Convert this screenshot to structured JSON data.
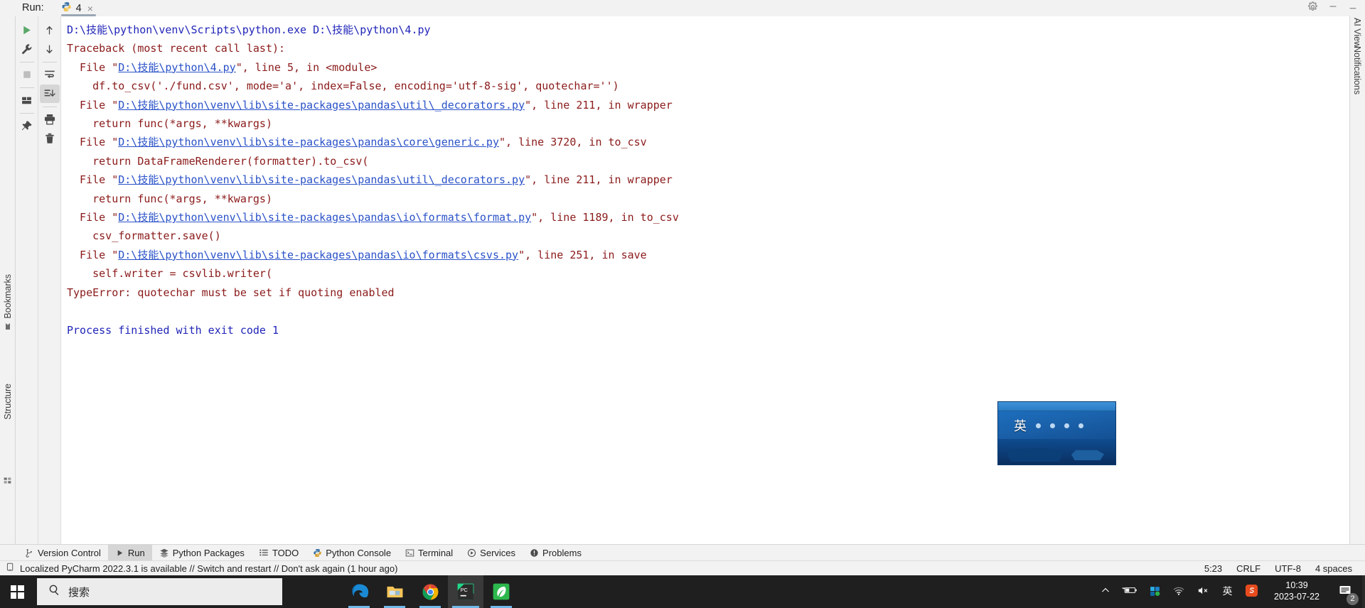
{
  "ide": {
    "run_label": "Run:",
    "run_tab": {
      "name": "4",
      "close": "×",
      "icon": "python-file-icon"
    },
    "topbar_icons": [
      {
        "name": "settings-icon",
        "glyph": "⚙"
      },
      {
        "name": "minimize-icon",
        "glyph": "—"
      },
      {
        "name": "hide-icon",
        "glyph": "─"
      }
    ],
    "left_strip": {
      "bookmarks_label": "Bookmarks",
      "structure_label": "Structure"
    },
    "right_strip": {
      "ai_view_label": "AI View",
      "notifications_label": "Notifications"
    },
    "gutter_a": [
      {
        "name": "rerun-button",
        "icon": "green-play-icon",
        "selected": false
      },
      {
        "name": "debug-settings-button",
        "icon": "wrench-icon",
        "selected": false
      },
      {
        "name": "stop-button",
        "icon": "stop-square-icon",
        "selected": false
      },
      {
        "name": "layout-button",
        "icon": "panes-icon",
        "selected": false
      },
      {
        "name": "pin-tab-button",
        "icon": "pin-icon",
        "selected": false
      }
    ],
    "gutter_b": [
      {
        "name": "up-stack-trace-button",
        "icon": "arrow-up-icon",
        "selected": false
      },
      {
        "name": "down-stack-trace-button",
        "icon": "arrow-down-icon",
        "selected": false
      },
      {
        "name": "soft-wrap-button",
        "icon": "soft-wrap-icon",
        "selected": false
      },
      {
        "name": "scroll-to-end-button",
        "icon": "scroll-to-end-icon",
        "selected": true
      },
      {
        "name": "print-button",
        "icon": "printer-icon",
        "selected": false
      },
      {
        "name": "clear-all-button",
        "icon": "trash-icon",
        "selected": false
      }
    ],
    "console": {
      "lines": [
        {
          "type": "cmd",
          "segments": [
            {
              "t": "text",
              "v": "D:\\技能\\python\\venv\\Scripts\\python.exe D:\\技能\\python\\4.py"
            }
          ]
        },
        {
          "type": "err",
          "segments": [
            {
              "t": "text",
              "v": "Traceback (most recent call last):"
            }
          ]
        },
        {
          "type": "err",
          "segments": [
            {
              "t": "text",
              "v": "  File \""
            },
            {
              "t": "link",
              "v": "D:\\技能\\python\\4.py"
            },
            {
              "t": "text",
              "v": "\", line 5, in <module>"
            }
          ]
        },
        {
          "type": "err",
          "segments": [
            {
              "t": "text",
              "v": "    df.to_csv('./fund.csv', mode='a', index=False, encoding='utf-8-sig', quotechar='')"
            }
          ]
        },
        {
          "type": "err",
          "segments": [
            {
              "t": "text",
              "v": "  File \""
            },
            {
              "t": "link",
              "v": "D:\\技能\\python\\venv\\lib\\site-packages\\pandas\\util\\_decorators.py"
            },
            {
              "t": "text",
              "v": "\", line 211, in wrapper"
            }
          ]
        },
        {
          "type": "err",
          "segments": [
            {
              "t": "text",
              "v": "    return func(*args, **kwargs)"
            }
          ]
        },
        {
          "type": "err",
          "segments": [
            {
              "t": "text",
              "v": "  File \""
            },
            {
              "t": "link",
              "v": "D:\\技能\\python\\venv\\lib\\site-packages\\pandas\\core\\generic.py"
            },
            {
              "t": "text",
              "v": "\", line 3720, in to_csv"
            }
          ]
        },
        {
          "type": "err",
          "segments": [
            {
              "t": "text",
              "v": "    return DataFrameRenderer(formatter).to_csv("
            }
          ]
        },
        {
          "type": "err",
          "segments": [
            {
              "t": "text",
              "v": "  File \""
            },
            {
              "t": "link",
              "v": "D:\\技能\\python\\venv\\lib\\site-packages\\pandas\\util\\_decorators.py"
            },
            {
              "t": "text",
              "v": "\", line 211, in wrapper"
            }
          ]
        },
        {
          "type": "err",
          "segments": [
            {
              "t": "text",
              "v": "    return func(*args, **kwargs)"
            }
          ]
        },
        {
          "type": "err",
          "segments": [
            {
              "t": "text",
              "v": "  File \""
            },
            {
              "t": "link",
              "v": "D:\\技能\\python\\venv\\lib\\site-packages\\pandas\\io\\formats\\format.py"
            },
            {
              "t": "text",
              "v": "\", line 1189, in to_csv"
            }
          ]
        },
        {
          "type": "err",
          "segments": [
            {
              "t": "text",
              "v": "    csv_formatter.save()"
            }
          ]
        },
        {
          "type": "err",
          "segments": [
            {
              "t": "text",
              "v": "  File \""
            },
            {
              "t": "link",
              "v": "D:\\技能\\python\\venv\\lib\\site-packages\\pandas\\io\\formats\\csvs.py"
            },
            {
              "t": "text",
              "v": "\", line 251, in save"
            }
          ]
        },
        {
          "type": "err",
          "segments": [
            {
              "t": "text",
              "v": "    self.writer = csvlib.writer("
            }
          ]
        },
        {
          "type": "err",
          "segments": [
            {
              "t": "text",
              "v": "TypeError: quotechar must be set if quoting enabled"
            }
          ]
        },
        {
          "type": "blank",
          "segments": [
            {
              "t": "text",
              "v": " "
            }
          ]
        },
        {
          "type": "done",
          "segments": [
            {
              "t": "text",
              "v": "Process finished with exit code 1"
            }
          ]
        }
      ]
    },
    "tool_window_tabs": [
      {
        "label": "Version Control",
        "icon": "branch-icon",
        "active": false
      },
      {
        "label": "Run",
        "icon": "play-triangle-icon",
        "active": true
      },
      {
        "label": "Python Packages",
        "icon": "layers-icon",
        "active": false
      },
      {
        "label": "TODO",
        "icon": "list-icon",
        "active": false
      },
      {
        "label": "Python Console",
        "icon": "python-icon",
        "active": false
      },
      {
        "label": "Terminal",
        "icon": "terminal-icon",
        "active": false
      },
      {
        "label": "Services",
        "icon": "services-play-icon",
        "active": false
      },
      {
        "label": "Problems",
        "icon": "problems-icon",
        "active": false
      }
    ],
    "status_bar": {
      "message_icon": "ide-update-icon",
      "message": "Localized PyCharm 2022.3.1 is available // Switch and restart // Don't ask again (1 hour ago)",
      "caret_position": "5:23",
      "line_separator": "CRLF",
      "encoding": "UTF-8",
      "indent": "4 spaces"
    }
  },
  "ime_panel": {
    "mode_glyph": "英",
    "keys": [
      "·",
      "·",
      "、",
      "·"
    ]
  },
  "taskbar": {
    "start_name": "start-button",
    "search": {
      "placeholder": "搜索",
      "icon": "search-icon"
    },
    "apps": [
      {
        "name": "task-edge",
        "icon": "edge-icon",
        "state": "open"
      },
      {
        "name": "task-file-explorer",
        "icon": "folder-icon",
        "state": "open"
      },
      {
        "name": "task-chrome",
        "icon": "chrome-icon",
        "state": "open"
      },
      {
        "name": "task-pycharm",
        "icon": "pycharm-icon",
        "state": "active"
      },
      {
        "name": "task-wechat-dev",
        "icon": "leaf-icon",
        "state": "open"
      }
    ],
    "tray": [
      {
        "name": "show-hidden-icons",
        "glyph": "∧"
      },
      {
        "name": "battery-icon",
        "glyph": "▭"
      },
      {
        "name": "onedrive-icon",
        "glyph": "◩"
      },
      {
        "name": "wifi-icon",
        "glyph": "◠"
      },
      {
        "name": "volume-muted-icon",
        "glyph": "✕"
      },
      {
        "name": "ime-language-icon",
        "glyph": "英"
      },
      {
        "name": "sogou-input-icon",
        "glyph": "S"
      }
    ],
    "clock": {
      "time": "10:39",
      "date": "2023-07-22"
    },
    "notifications": {
      "count": "2",
      "icon": "notification-icon"
    }
  },
  "colors": {
    "console_error": "#8b1a1a",
    "console_command": "#2025b8",
    "console_link": "#2a52c8",
    "ide_chrome": "#f2f2f2",
    "taskbar": "#1f1f1f",
    "accent_run": "#59a869"
  }
}
